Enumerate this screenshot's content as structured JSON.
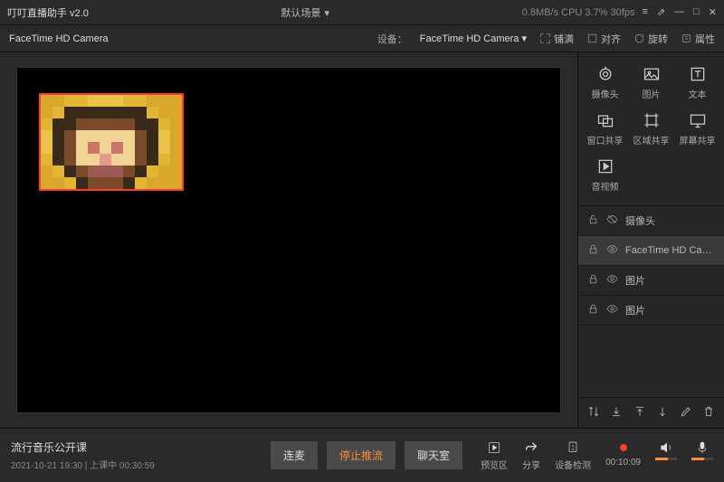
{
  "titlebar": {
    "app": "叮叮直播助手 v2.0",
    "scene": "默认场景",
    "stats": "0.8MB/s  CPU 3.7%  30fps"
  },
  "toolbar": {
    "source": "FaceTime HD Camera",
    "device_label": "设备：",
    "device": "FaceTime HD Camera",
    "fill": "铺满",
    "align": "对齐",
    "rotate": "旋转",
    "props": "属性"
  },
  "tools": {
    "camera": "摄像头",
    "image": "图片",
    "text": "文本",
    "window": "窗口共享",
    "region": "区域共享",
    "screen": "屏幕共享",
    "audiovideo": "音视频"
  },
  "layers": [
    {
      "name": "摄像头",
      "locked": false,
      "visible": false
    },
    {
      "name": "FaceTime HD Came…",
      "locked": true,
      "visible": true,
      "selected": true
    },
    {
      "name": "图片",
      "locked": true,
      "visible": true
    },
    {
      "name": "图片",
      "locked": true,
      "visible": true
    }
  ],
  "bottom": {
    "class_name": "流行音乐公开课",
    "class_meta": "2021-10-21 19:30  |  上课中 00:30:59",
    "btn_mic": "连麦",
    "btn_stop": "停止推流",
    "btn_chat": "聊天室",
    "ctrl_preview": "预览区",
    "ctrl_share": "分享",
    "ctrl_device": "设备检测",
    "ctrl_rec": "00:10:09"
  }
}
